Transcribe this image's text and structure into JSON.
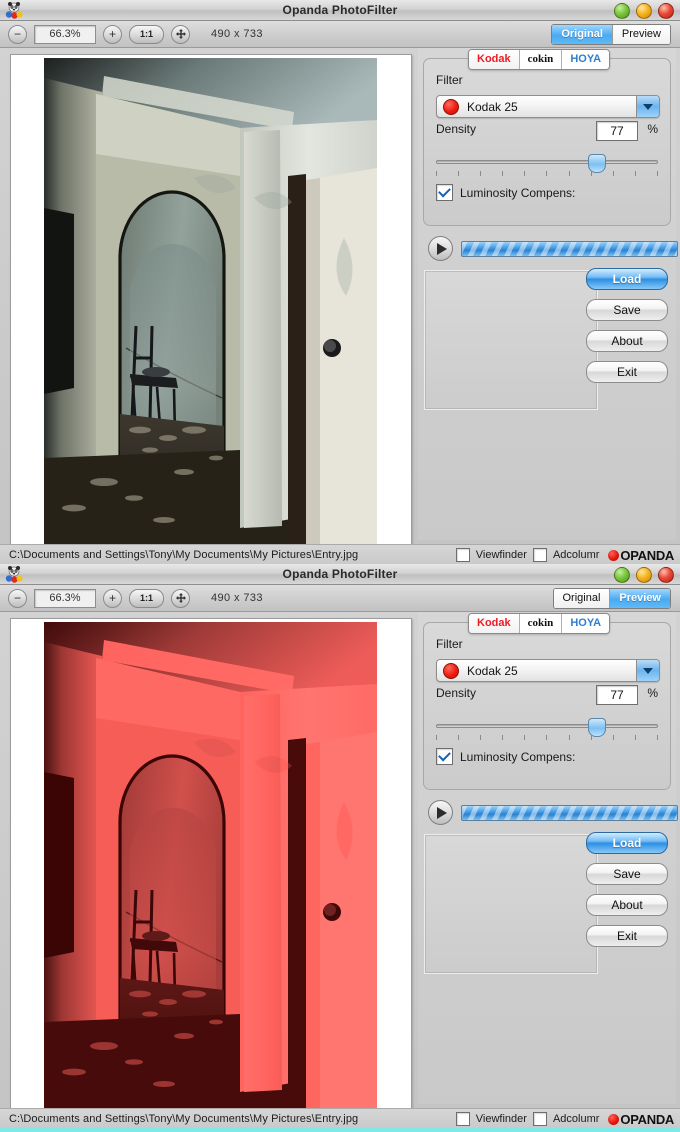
{
  "app": {
    "title": "Opanda PhotoFilter",
    "icon": "panda-icon",
    "window_buttons": [
      "minimize-green",
      "zoom-yellow",
      "close-red"
    ]
  },
  "toolbar": {
    "zoom_out_label": "−",
    "zoom_value": "66.3%",
    "zoom_in_label": "+",
    "actual_size_label": "1:1",
    "fit_label": "✥",
    "dimensions": "490 x 733",
    "view_modes": [
      "Original",
      "Preview"
    ]
  },
  "windows": [
    {
      "active_view_mode": "Original",
      "image_variant": "unfiltered"
    },
    {
      "active_view_mode": "Preview",
      "image_variant": "red-filtered"
    }
  ],
  "panel": {
    "brand_tabs": [
      {
        "label": "Kodak",
        "color": "#ec1c24",
        "selected": true
      },
      {
        "label": "cokin",
        "color": "#111111",
        "selected": false
      },
      {
        "label": "HOYA",
        "color": "#2f7fd0",
        "selected": false
      }
    ],
    "filter_label": "Filter",
    "filter_value": "Kodak 25",
    "filter_swatch_color": "#ee1b12",
    "density_label": "Density",
    "density_value": "77",
    "density_unit": "%",
    "density_slider_percent": 69,
    "luminosity_label": "Luminosity Compens:",
    "luminosity_checked": true,
    "play_icon": "play-icon",
    "progress_percent": 100,
    "buttons": [
      {
        "label": "Load",
        "primary": true
      },
      {
        "label": "Save",
        "primary": false
      },
      {
        "label": "About",
        "primary": false
      },
      {
        "label": "Exit",
        "primary": false
      }
    ]
  },
  "status": {
    "path": "C:\\Documents and Settings\\Tony\\My Documents\\My Pictures\\Entry.jpg",
    "viewfinder_label": "Viewfinder",
    "viewfinder_checked": false,
    "adcolumn_label": "Adcolumr",
    "adcolumn_checked": false,
    "brand_logo": "OPANDA"
  }
}
